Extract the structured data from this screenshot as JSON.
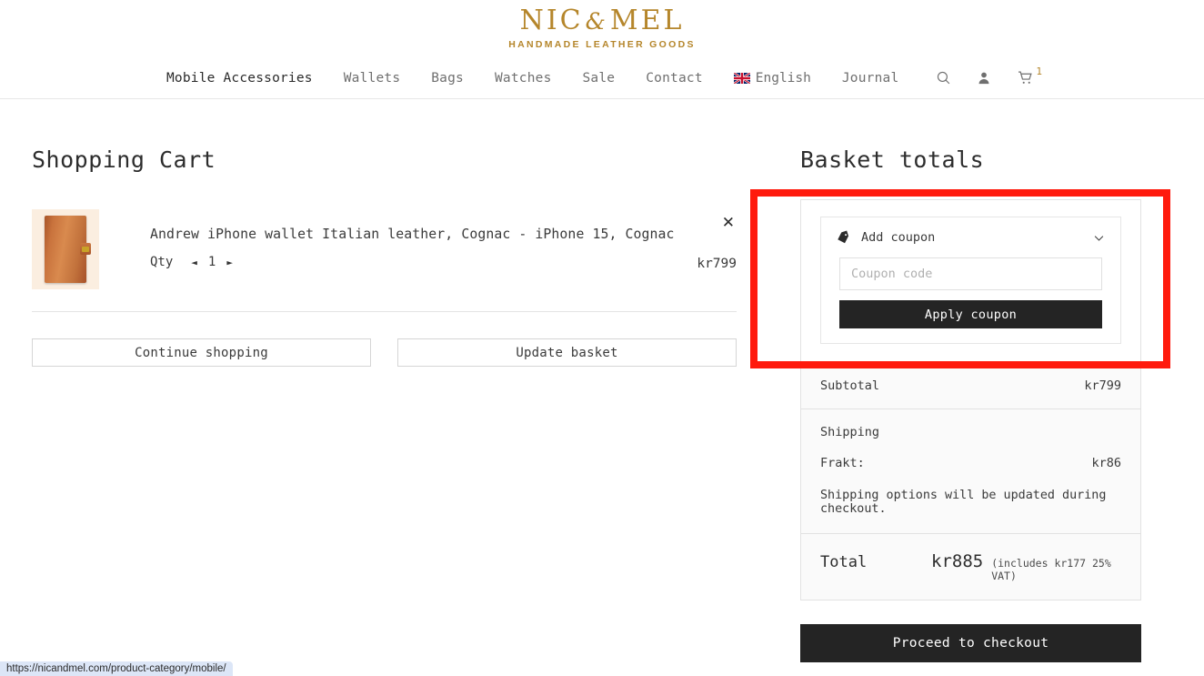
{
  "brand": {
    "name_part1": "NIC",
    "ampersand": "&",
    "name_part2": "MEL",
    "tagline": "HANDMADE LEATHER GOODS",
    "gold": "#b5862b"
  },
  "nav": {
    "items": [
      {
        "label": "Mobile Accessories",
        "active": true
      },
      {
        "label": "Wallets",
        "active": false
      },
      {
        "label": "Bags",
        "active": false
      },
      {
        "label": "Watches",
        "active": false
      },
      {
        "label": "Sale",
        "active": false
      },
      {
        "label": "Contact",
        "active": false
      }
    ],
    "language": "English",
    "journal": "Journal",
    "icons": [
      "search-icon",
      "account-icon",
      "cart-icon"
    ],
    "cart_count": "1"
  },
  "cart": {
    "title": "Shopping Cart",
    "item": {
      "name": "Andrew iPhone wallet Italian leather, Cognac - iPhone 15, Cognac",
      "qty_label": "Qty",
      "qty_value": "1",
      "qty_decrease": "◄",
      "qty_increase": "►",
      "price": "kr799",
      "remove": "✕",
      "thumb_bg": "#fbeee0",
      "thumb_leather": "#c9733d"
    },
    "continue_label": "Continue shopping",
    "update_label": "Update basket"
  },
  "totals": {
    "title": "Basket totals",
    "coupon": {
      "header_label": "Add coupon",
      "icon": "coupon-tag-icon",
      "chevron": "chevron-down-icon",
      "input_placeholder": "Coupon code",
      "input_value": "",
      "apply_label": "Apply coupon"
    },
    "subtotal": {
      "label": "Subtotal",
      "value": "kr799"
    },
    "shipping": {
      "label": "Shipping",
      "method_label": "Frakt:",
      "method_value": "kr86",
      "note": "Shipping options will be updated during checkout."
    },
    "total": {
      "label": "Total",
      "amount": "kr885",
      "vat_note": "(includes kr177 25% VAT)"
    },
    "checkout_label": "Proceed to checkout"
  },
  "annotation": {
    "highlight_color": "#ff1a0d"
  },
  "statusbar": {
    "url": "https://nicandmel.com/product-category/mobile/"
  }
}
